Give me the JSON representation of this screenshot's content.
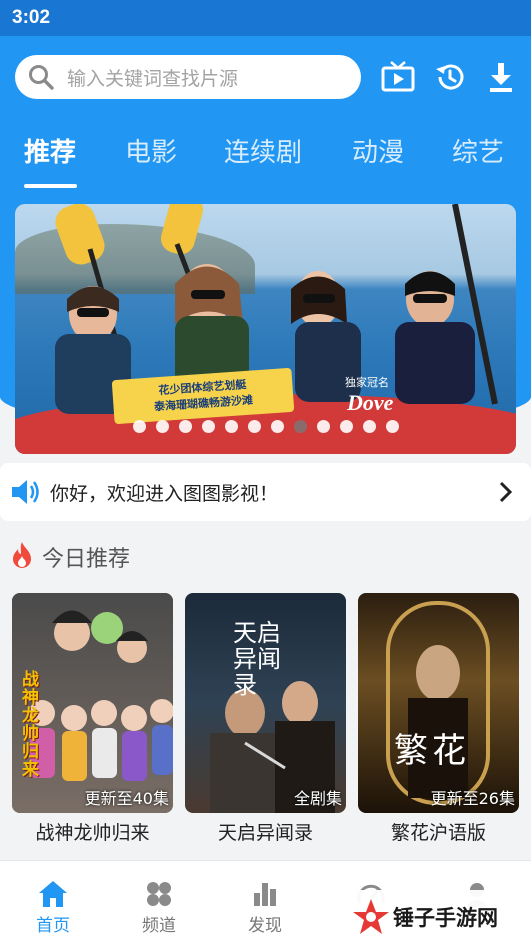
{
  "status": {
    "time": "3:02"
  },
  "search": {
    "placeholder": "输入关键词查找片源"
  },
  "tabs": [
    {
      "label": "推荐",
      "active": true
    },
    {
      "label": "电影"
    },
    {
      "label": "连续剧"
    },
    {
      "label": "动漫"
    },
    {
      "label": "综艺"
    }
  ],
  "banner": {
    "tag_line1": "花少团体综艺划艇",
    "tag_line2": "泰海珊瑚礁畅游沙滩",
    "sponsor": "独家冠名",
    "logo": "Dove",
    "dot_count": 12,
    "active_dot": 7
  },
  "notice": {
    "text": "你好，欢迎进入图图影视！"
  },
  "section": {
    "title": "今日推荐"
  },
  "cards": [
    {
      "title": "战神龙帅归来",
      "badge": "更新至40集",
      "poster_text": "战神龙帅归来"
    },
    {
      "title": "天启异闻录",
      "badge": "全剧集",
      "poster_text": "天启异闻录"
    },
    {
      "title": "繁花沪语版",
      "badge": "更新至26集",
      "poster_text": "繁花"
    }
  ],
  "nav": [
    {
      "label": "首页",
      "icon": "home-icon",
      "active": true
    },
    {
      "label": "频道",
      "icon": "channel-icon"
    },
    {
      "label": "发现",
      "icon": "discover-icon"
    },
    {
      "label": "",
      "icon": "speed-icon"
    },
    {
      "label": "",
      "icon": "profile-icon"
    }
  ],
  "watermark": {
    "text": "锤子手游网"
  },
  "colors": {
    "primary": "#2196f3",
    "status_bar": "#1976d2",
    "hot": "#f04a3c"
  }
}
